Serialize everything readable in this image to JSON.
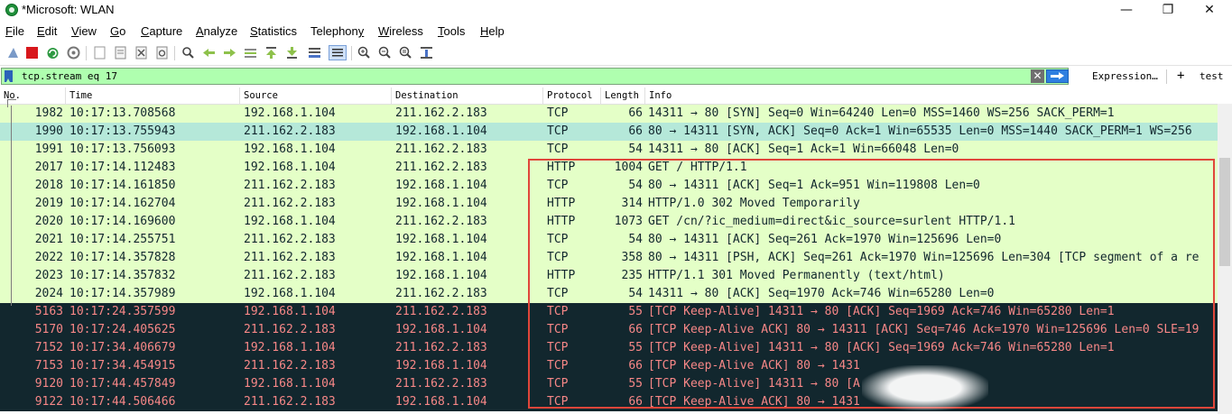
{
  "window": {
    "title": "*Microsoft: WLAN",
    "controls": [
      "—",
      "❐",
      "✕"
    ]
  },
  "menu": [
    {
      "label": "File",
      "u": "F",
      "rest": "ile"
    },
    {
      "label": "Edit",
      "u": "E",
      "rest": "dit"
    },
    {
      "label": "View",
      "u": "V",
      "rest": "iew"
    },
    {
      "label": "Go",
      "u": "G",
      "rest": "o"
    },
    {
      "label": "Capture",
      "u": "C",
      "rest": "apture"
    },
    {
      "label": "Analyze",
      "u": "A",
      "rest": "nalyze"
    },
    {
      "label": "Statistics",
      "u": "S",
      "rest": "tatistics"
    },
    {
      "label": "Telephony",
      "u": "y",
      "pre": "Telephon"
    },
    {
      "label": "Wireless",
      "u": "W",
      "rest": "ireless"
    },
    {
      "label": "Tools",
      "u": "T",
      "rest": "ools"
    },
    {
      "label": "Help",
      "u": "H",
      "rest": "elp"
    }
  ],
  "toolbar_icons": [
    "shark-fin-icon",
    "stop-icon",
    "restart-icon",
    "options-gear-icon",
    "open-file-icon",
    "save-icon",
    "close-file-icon",
    "reload-icon",
    "find-icon",
    "back-arrow-icon",
    "forward-arrow-icon",
    "go-to-packet-icon",
    "first-packet-icon",
    "last-packet-icon",
    "autoscroll-icon",
    "colorize-icon",
    "zoom-in-icon",
    "zoom-out-icon",
    "normal-size-icon",
    "resize-columns-icon"
  ],
  "filter": {
    "value": "tcp.stream eq 17",
    "expression_label": "Expression…",
    "add_label": "+",
    "button_label": "test"
  },
  "columns": [
    "No.",
    "Time",
    "Source",
    "Destination",
    "Protocol",
    "Length",
    "Info"
  ],
  "rows": [
    {
      "no": "1982",
      "time": "10:17:13.708568",
      "src": "192.168.1.104",
      "dst": "211.162.2.183",
      "proto": "TCP",
      "len": "66",
      "info": "14311 → 80 [SYN] Seq=0 Win=64240 Len=0 MSS=1460 WS=256 SACK_PERM=1",
      "style": "green"
    },
    {
      "no": "1990",
      "time": "10:17:13.755943",
      "src": "211.162.2.183",
      "dst": "192.168.1.104",
      "proto": "TCP",
      "len": "66",
      "info": "80 → 14311 [SYN, ACK] Seq=0 Ack=1 Win=65535 Len=0 MSS=1440 SACK_PERM=1 WS=256",
      "style": "sel"
    },
    {
      "no": "1991",
      "time": "10:17:13.756093",
      "src": "192.168.1.104",
      "dst": "211.162.2.183",
      "proto": "TCP",
      "len": "54",
      "info": "14311 → 80 [ACK] Seq=1 Ack=1 Win=66048 Len=0",
      "style": "green"
    },
    {
      "no": "2017",
      "time": "10:17:14.112483",
      "src": "192.168.1.104",
      "dst": "211.162.2.183",
      "proto": "HTTP",
      "len": "1004",
      "info": "GET / HTTP/1.1",
      "style": "green"
    },
    {
      "no": "2018",
      "time": "10:17:14.161850",
      "src": "211.162.2.183",
      "dst": "192.168.1.104",
      "proto": "TCP",
      "len": "54",
      "info": "80 → 14311 [ACK] Seq=1 Ack=951 Win=119808 Len=0",
      "style": "green"
    },
    {
      "no": "2019",
      "time": "10:17:14.162704",
      "src": "211.162.2.183",
      "dst": "192.168.1.104",
      "proto": "HTTP",
      "len": "314",
      "info": "HTTP/1.0 302 Moved Temporarily",
      "style": "green"
    },
    {
      "no": "2020",
      "time": "10:17:14.169600",
      "src": "192.168.1.104",
      "dst": "211.162.2.183",
      "proto": "HTTP",
      "len": "1073",
      "info": "GET /cn/?ic_medium=direct&ic_source=surlent HTTP/1.1",
      "style": "green"
    },
    {
      "no": "2021",
      "time": "10:17:14.255751",
      "src": "211.162.2.183",
      "dst": "192.168.1.104",
      "proto": "TCP",
      "len": "54",
      "info": "80 → 14311 [ACK] Seq=261 Ack=1970 Win=125696 Len=0",
      "style": "green"
    },
    {
      "no": "2022",
      "time": "10:17:14.357828",
      "src": "211.162.2.183",
      "dst": "192.168.1.104",
      "proto": "TCP",
      "len": "358",
      "info": "80 → 14311 [PSH, ACK] Seq=261 Ack=1970 Win=125696 Len=304 [TCP segment of a re",
      "style": "green"
    },
    {
      "no": "2023",
      "time": "10:17:14.357832",
      "src": "211.162.2.183",
      "dst": "192.168.1.104",
      "proto": "HTTP",
      "len": "235",
      "info": "HTTP/1.1 301 Moved Permanently  (text/html)",
      "style": "green"
    },
    {
      "no": "2024",
      "time": "10:17:14.357989",
      "src": "192.168.1.104",
      "dst": "211.162.2.183",
      "proto": "TCP",
      "len": "54",
      "info": "14311 → 80 [ACK] Seq=1970 Ack=746 Win=65280 Len=0",
      "style": "green"
    },
    {
      "no": "5163",
      "time": "10:17:24.357599",
      "src": "192.168.1.104",
      "dst": "211.162.2.183",
      "proto": "TCP",
      "len": "55",
      "info": "[TCP Keep-Alive] 14311 → 80 [ACK] Seq=1969 Ack=746 Win=65280 Len=1",
      "style": "dark"
    },
    {
      "no": "5170",
      "time": "10:17:24.405625",
      "src": "211.162.2.183",
      "dst": "192.168.1.104",
      "proto": "TCP",
      "len": "66",
      "info": "[TCP Keep-Alive ACK] 80 → 14311 [ACK] Seq=746 Ack=1970 Win=125696 Len=0 SLE=19",
      "style": "dark"
    },
    {
      "no": "7152",
      "time": "10:17:34.406679",
      "src": "192.168.1.104",
      "dst": "211.162.2.183",
      "proto": "TCP",
      "len": "55",
      "info": "[TCP Keep-Alive] 14311 → 80 [ACK] Seq=1969 Ack=746 Win=65280 Len=1",
      "style": "dark"
    },
    {
      "no": "7153",
      "time": "10:17:34.454915",
      "src": "211.162.2.183",
      "dst": "192.168.1.104",
      "proto": "TCP",
      "len": "66",
      "info": "[TCP Keep-Alive ACK] 80 → 1431",
      "style": "dark"
    },
    {
      "no": "9120",
      "time": "10:17:44.457849",
      "src": "192.168.1.104",
      "dst": "211.162.2.183",
      "proto": "TCP",
      "len": "55",
      "info": "[TCP Keep-Alive] 14311 → 80 [A",
      "style": "dark"
    },
    {
      "no": "9122",
      "time": "10:17:44.506466",
      "src": "211.162.2.183",
      "dst": "192.168.1.104",
      "proto": "TCP",
      "len": "66",
      "info": "[TCP Keep-Alive ACK] 80 → 1431",
      "style": "dark"
    }
  ],
  "colors": {
    "filter_valid_bg": "#afffaf",
    "tcp_green": "#e4ffc7",
    "selected": "#b5e8d9",
    "keepalive_bg": "#12272e",
    "keepalive_fg": "#f78787",
    "annotation_box": "#e0463a"
  }
}
